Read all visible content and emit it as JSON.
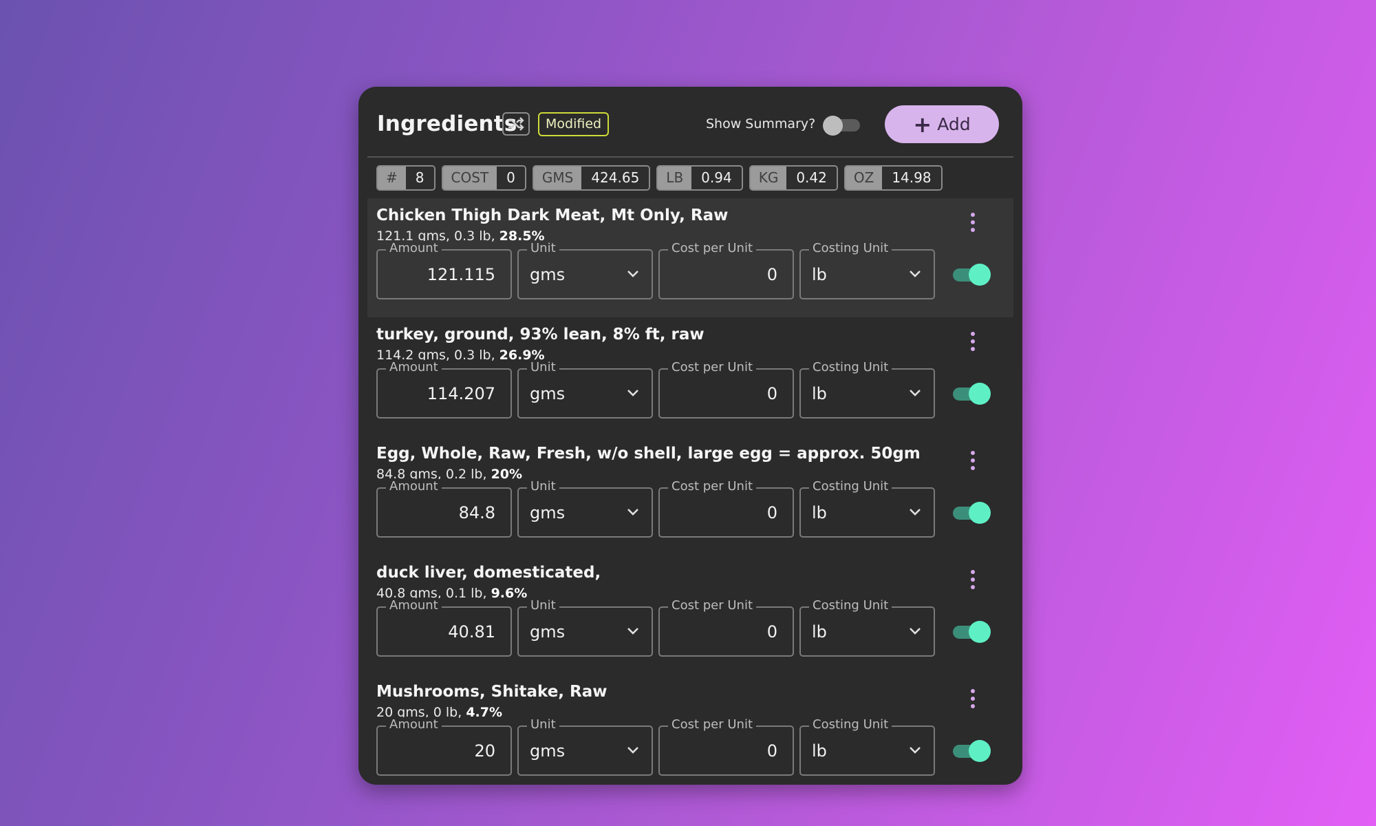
{
  "header": {
    "title": "Ingredients",
    "modified_badge": "Modified",
    "show_summary_label": "Show Summary?",
    "show_summary_on": false,
    "add_label": "Add"
  },
  "stats": [
    {
      "label": "#",
      "value": "8"
    },
    {
      "label": "COST",
      "value": "0"
    },
    {
      "label": "GMS",
      "value": "424.65"
    },
    {
      "label": "LB",
      "value": "0.94"
    },
    {
      "label": "KG",
      "value": "0.42"
    },
    {
      "label": "OZ",
      "value": "14.98"
    }
  ],
  "field_labels": {
    "amount": "Amount",
    "unit": "Unit",
    "cost_per_unit": "Cost per Unit",
    "costing_unit": "Costing Unit"
  },
  "ingredients": [
    {
      "name": "Chicken Thigh Dark Meat, Mt Only, Raw",
      "summary": "121.1 gms, 0.3 lb, ",
      "percent": "28.5%",
      "amount": "121.115",
      "unit": "gms",
      "cost_per_unit": "0",
      "costing_unit": "lb",
      "enabled": true
    },
    {
      "name": "turkey, ground, 93% lean, 8% ft, raw",
      "summary": "114.2 gms, 0.3 lb, ",
      "percent": "26.9%",
      "amount": "114.207",
      "unit": "gms",
      "cost_per_unit": "0",
      "costing_unit": "lb",
      "enabled": true
    },
    {
      "name": "Egg, Whole, Raw, Fresh, w/o shell, large egg = approx. 50gm",
      "summary": "84.8 gms, 0.2 lb, ",
      "percent": "20%",
      "amount": "84.8",
      "unit": "gms",
      "cost_per_unit": "0",
      "costing_unit": "lb",
      "enabled": true
    },
    {
      "name": "duck liver, domesticated,",
      "summary": "40.8 gms, 0.1 lb, ",
      "percent": "9.6%",
      "amount": "40.81",
      "unit": "gms",
      "cost_per_unit": "0",
      "costing_unit": "lb",
      "enabled": true
    },
    {
      "name": "Mushrooms, Shitake, Raw",
      "summary": "20 gms, 0 lb, ",
      "percent": "4.7%",
      "amount": "20",
      "unit": "gms",
      "cost_per_unit": "0",
      "costing_unit": "lb",
      "enabled": true
    }
  ],
  "icons": {
    "shuffle": "shuffle-icon",
    "plus": "plus-icon",
    "menu": "more-vert-icon",
    "chevron": "chevron-down-icon"
  },
  "colors": {
    "accent_purple": "#d8b4ec",
    "toggle_on": "#5ef0c4",
    "modified_badge": "#cddc39",
    "panel_bg": "#2b2b2b"
  }
}
